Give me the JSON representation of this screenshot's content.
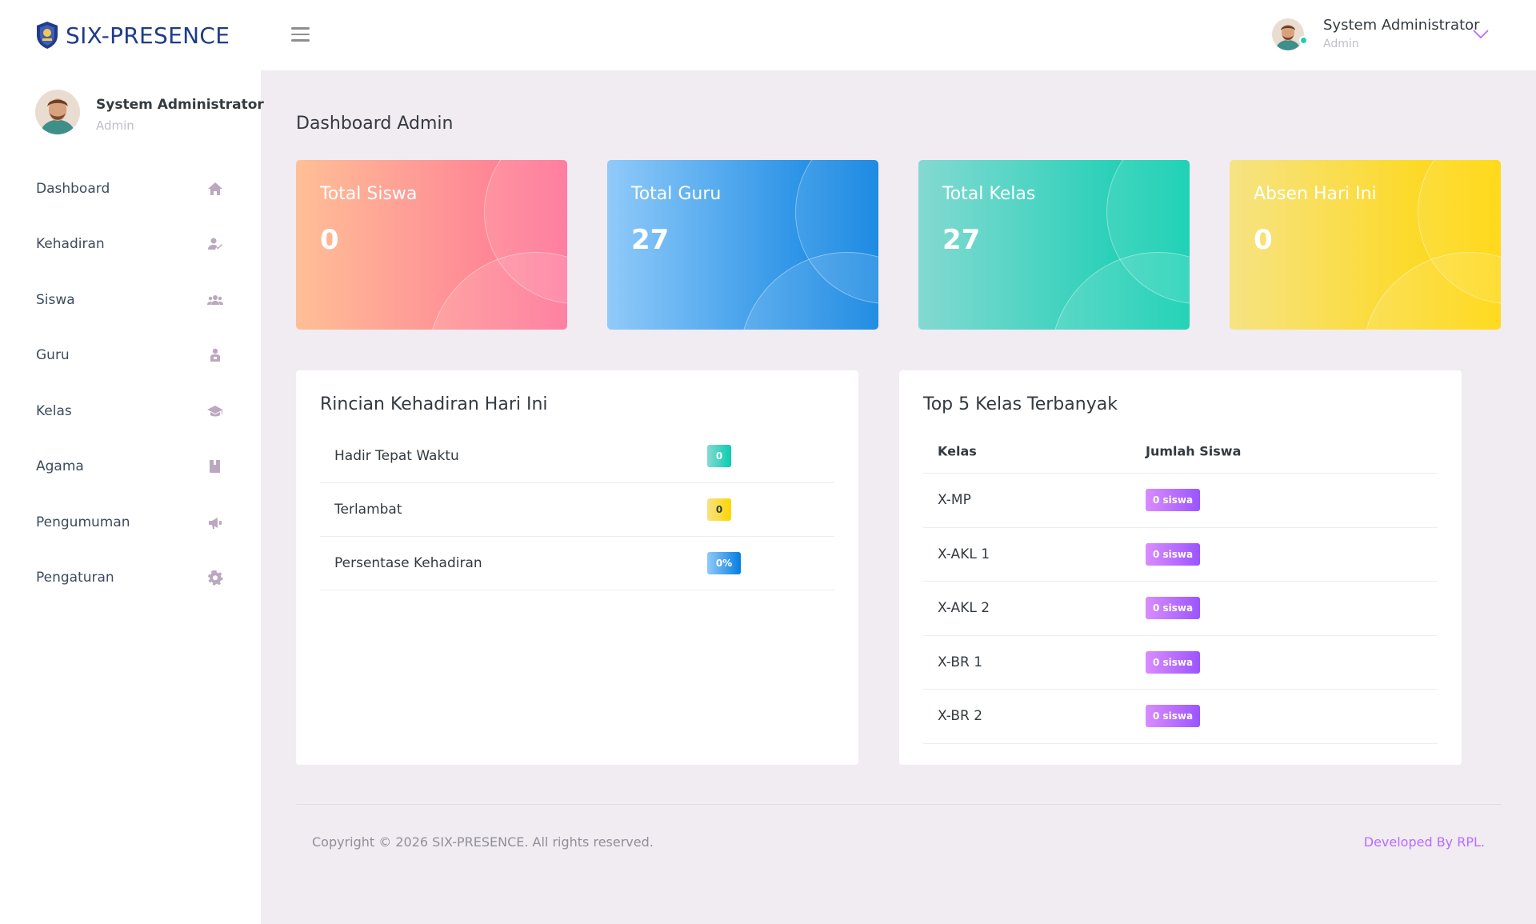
{
  "brand": {
    "name": "SIX-PRESENCE"
  },
  "topbar": {
    "user_name": "System Administrator",
    "user_role": "Admin"
  },
  "sidebar": {
    "profile": {
      "name": "System Administrator",
      "role": "Admin"
    },
    "items": [
      {
        "label": "Dashboard",
        "icon": "home-icon"
      },
      {
        "label": "Kehadiran",
        "icon": "user-check-icon"
      },
      {
        "label": "Siswa",
        "icon": "users-icon"
      },
      {
        "label": "Guru",
        "icon": "teacher-icon"
      },
      {
        "label": "Kelas",
        "icon": "graduation-cap-icon"
      },
      {
        "label": "Agama",
        "icon": "book-icon"
      },
      {
        "label": "Pengumuman",
        "icon": "megaphone-icon"
      },
      {
        "label": "Pengaturan",
        "icon": "gear-icon"
      }
    ]
  },
  "page": {
    "title": "Dashboard Admin"
  },
  "stats": [
    {
      "label": "Total Siswa",
      "value": "0"
    },
    {
      "label": "Total Guru",
      "value": "27"
    },
    {
      "label": "Total Kelas",
      "value": "27"
    },
    {
      "label": "Absen Hari Ini",
      "value": "0"
    }
  ],
  "attendance": {
    "title": "Rincian Kehadiran Hari Ini",
    "rows": [
      {
        "label": "Hadir Tepat Waktu",
        "value": "0"
      },
      {
        "label": "Terlambat",
        "value": "0"
      },
      {
        "label": "Persentase Kehadiran",
        "value": "0%"
      }
    ]
  },
  "top_classes": {
    "title": "Top 5 Kelas Terbanyak",
    "columns": [
      "Kelas",
      "Jumlah Siswa"
    ],
    "rows": [
      {
        "kelas": "X-MP",
        "jumlah": "0 siswa"
      },
      {
        "kelas": "X-AKL 1",
        "jumlah": "0 siswa"
      },
      {
        "kelas": "X-AKL 2",
        "jumlah": "0 siswa"
      },
      {
        "kelas": "X-BR 1",
        "jumlah": "0 siswa"
      },
      {
        "kelas": "X-BR 2",
        "jumlah": "0 siswa"
      }
    ]
  },
  "footer": {
    "copyright": "Copyright © 2026 SIX-PRESENCE. All rights reserved.",
    "developer": "Developed By RPL."
  },
  "colors": {
    "accent": "#b66dff",
    "brand": "#1f3b8a",
    "online": "#1bcfb4",
    "background": "#f1ebf2"
  }
}
